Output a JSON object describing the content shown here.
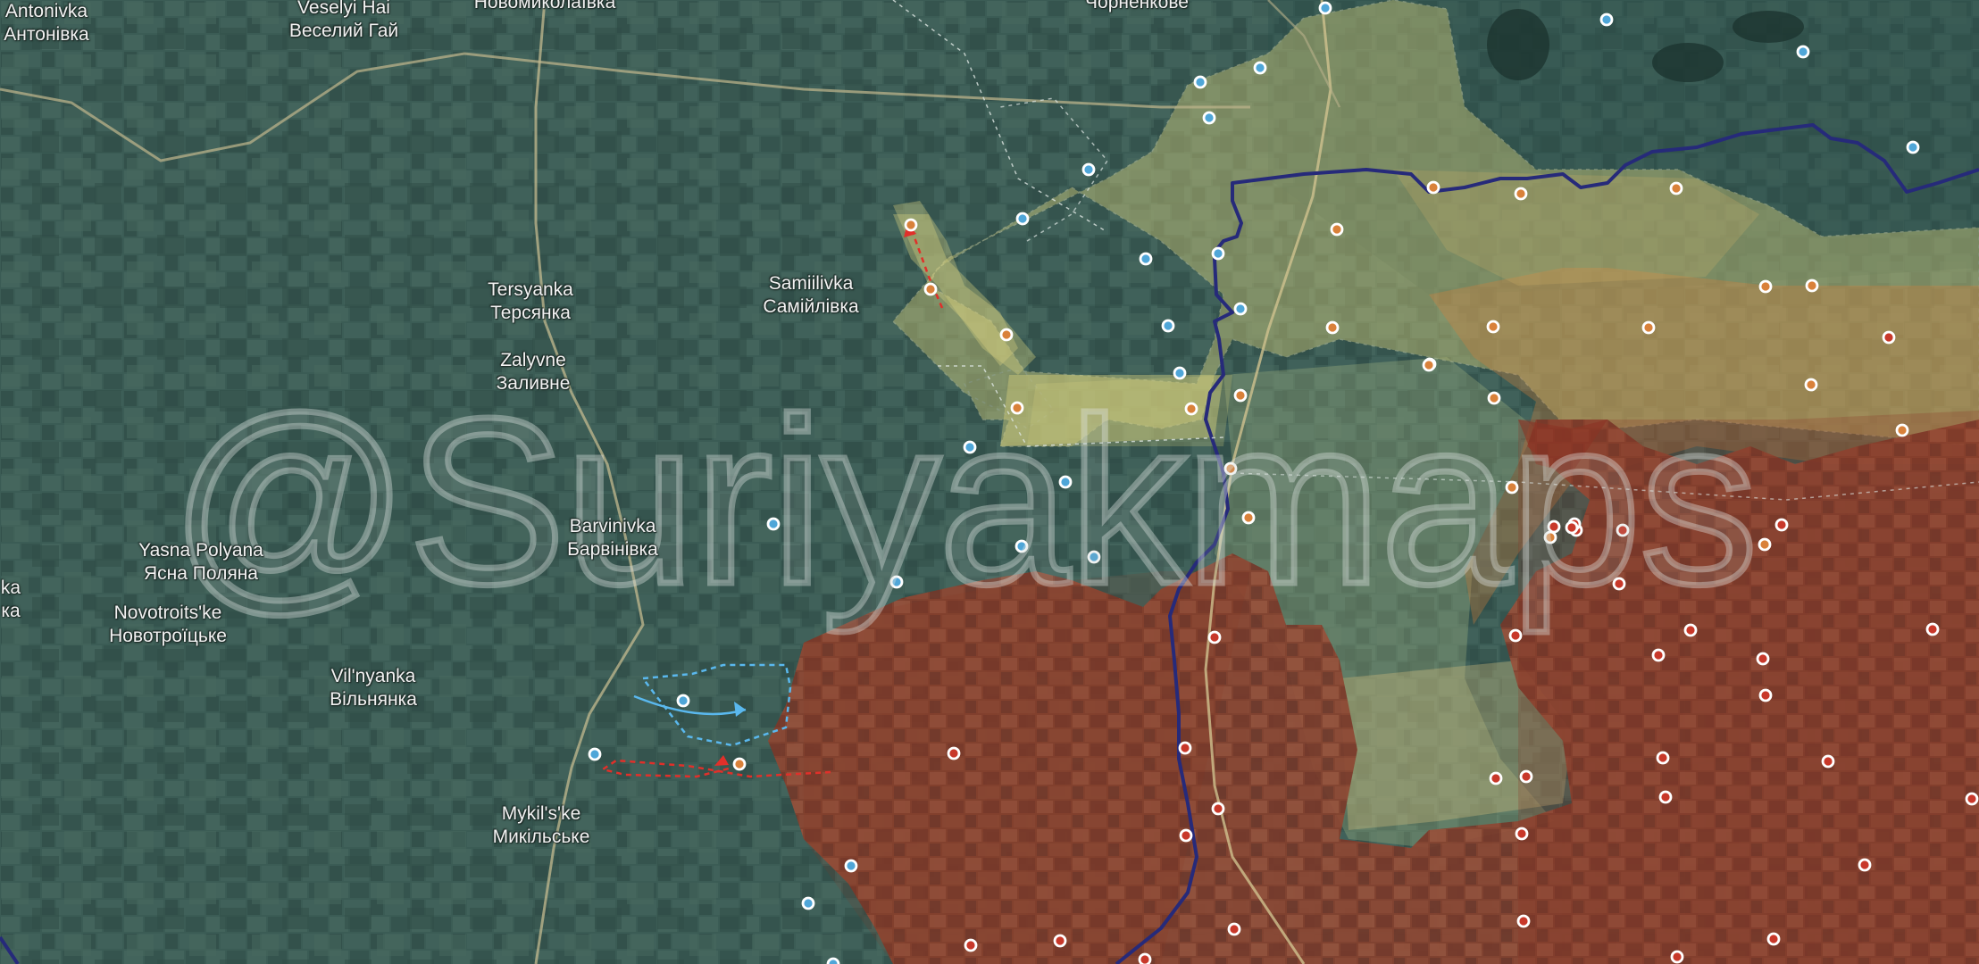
{
  "watermark": "@Suriyakmaps",
  "places": [
    {
      "id": "antonivka",
      "latin": "Antonivka",
      "cyrillic": "Антонівка"
    },
    {
      "id": "veselyi-hai",
      "latin": "Veselyi Hai",
      "cyrillic": "Веселий Гай"
    },
    {
      "id": "novomykolaivka",
      "latin": "",
      "cyrillic": "Новомиколаївка"
    },
    {
      "id": "chornenkove",
      "latin": "",
      "cyrillic": "Чорненкове"
    },
    {
      "id": "tersyanka",
      "latin": "Tersyanka",
      "cyrillic": "Терсянка"
    },
    {
      "id": "samiilivka",
      "latin": "Samiilivka",
      "cyrillic": "Самійлівка"
    },
    {
      "id": "zalyvne",
      "latin": "Zalyvne",
      "cyrillic": "Заливне"
    },
    {
      "id": "barvinivka",
      "latin": "Barvinivka",
      "cyrillic": "Барвінівка"
    },
    {
      "id": "yasna-polyana",
      "latin": "Yasna Polyana",
      "cyrillic": "Ясна Поляна"
    },
    {
      "id": "edge-ka",
      "latin": "ka",
      "cyrillic": "ка"
    },
    {
      "id": "novotroitske",
      "latin": "Novotroits'ke",
      "cyrillic": "Новотроїцьке"
    },
    {
      "id": "vilnyanka",
      "latin": "Vil'nyanka",
      "cyrillic": "Вільнянка"
    },
    {
      "id": "mykilske",
      "latin": "Mykil's'ke",
      "cyrillic": "Микільське"
    }
  ],
  "legend_colors": {
    "ukrainian_control": "#4fa6d8",
    "contested_zone": "#e7dc86",
    "russian_advance": "#d9813a",
    "russian_control": "#8a3424",
    "frontline": "#262a7a",
    "ukrainian_attack_arrow": "#5ab8ee",
    "russian_attack_arrow": "#e0302a"
  },
  "markers": {
    "blue_count": 34,
    "orange_count": 28,
    "red_count": 34
  }
}
